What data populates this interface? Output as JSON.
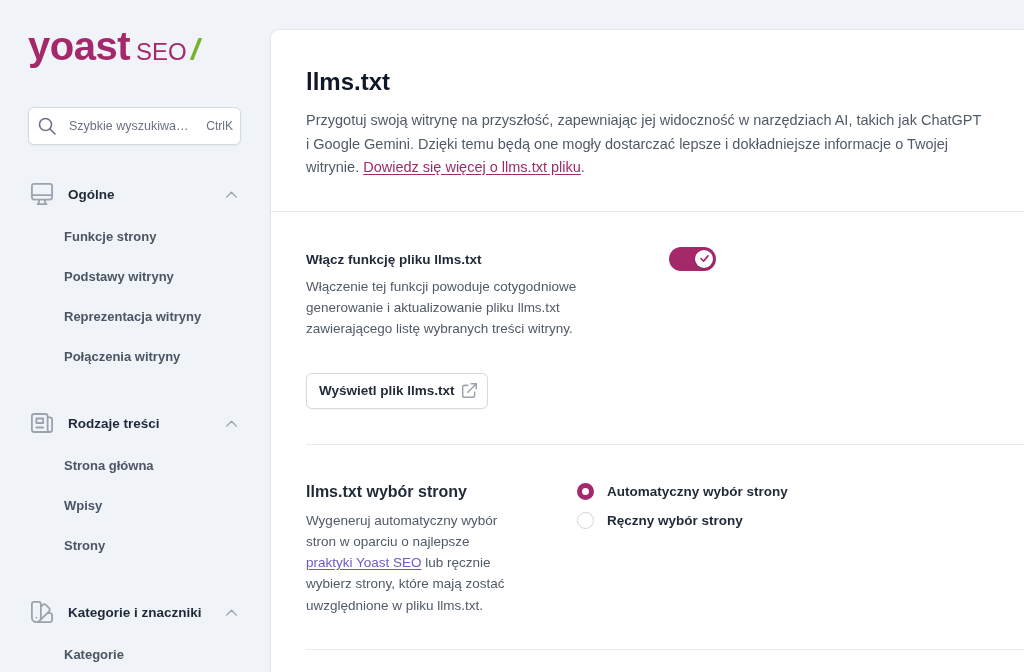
{
  "sidebar": {
    "logo": {
      "wordmark": "yoast",
      "product": "SEO"
    },
    "search": {
      "placeholder": "Szybkie wyszukiwa…",
      "shortcut": "CtrlK"
    },
    "groups": [
      {
        "label": "Ogólne",
        "expanded": true,
        "items": [
          {
            "label": "Funkcje strony",
            "selected": false
          },
          {
            "label": "Podstawy witryny",
            "selected": false
          },
          {
            "label": "Reprezentacja witryny",
            "selected": false
          },
          {
            "label": "Połączenia witryny",
            "selected": false
          }
        ]
      },
      {
        "label": "Rodzaje treści",
        "expanded": true,
        "items": [
          {
            "label": "Strona główna",
            "selected": false
          },
          {
            "label": "Wpisy",
            "selected": false
          },
          {
            "label": "Strony",
            "selected": false
          }
        ]
      },
      {
        "label": "Kategorie i znaczniki",
        "expanded": true,
        "items": [
          {
            "label": "Kategorie",
            "selected": false
          }
        ]
      }
    ]
  },
  "main": {
    "title": "llms.txt",
    "intro": [
      {
        "kind": "text",
        "text": "Przygotuj swoją witrynę na przyszłość, zapewniając jej widoczność w narzędziach AI, takich jak ChatGPT i Google Gemini. Dzięki temu będą one mogły dostarczać lepsze i dokładniejsze informacje o Twojej witrynie. "
      },
      {
        "kind": "link",
        "text": "Dowiedz się więcej o llms.txt pliku",
        "visited": false
      },
      {
        "kind": "text",
        "text": "."
      }
    ],
    "feature": {
      "label": "Włącz funkcję pliku llms.txt",
      "description": "Włączenie tej funkcji powoduje cotygodniowe generowanie i aktualizowanie pliku llms.txt zawierającego listę wybranych treści witryny.",
      "on": true
    },
    "view_button": {
      "label": "Wyświetl plik llms.txt"
    },
    "page_selection": {
      "title": "llms.txt wybór strony",
      "description": [
        {
          "kind": "text",
          "text": "Wygeneruj automatyczny wybór stron w oparciu o najlepsze "
        },
        {
          "kind": "link",
          "text": "praktyki Yoast SEO",
          "visited": true
        },
        {
          "kind": "text",
          "text": " lub ręcznie wybierz strony, które mają zostać uwzględnione w pliku llms.txt."
        }
      ],
      "options": [
        {
          "label": "Automatyczny wybór strony",
          "selected": true
        },
        {
          "label": "Ręczny wybór strony",
          "selected": false
        }
      ]
    }
  }
}
